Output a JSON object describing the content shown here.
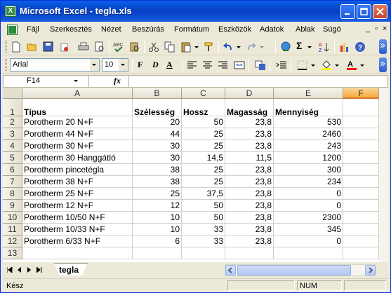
{
  "window": {
    "title": "Microsoft Excel - tegla.xls",
    "app_icon_letter": "X"
  },
  "menu": {
    "items": [
      "Fájl",
      "Szerkesztés",
      "Nézet",
      "Beszúrás",
      "Formátum",
      "Eszközök",
      "Adatok",
      "Ablak",
      "Súgó"
    ],
    "doc_controls": [
      "_",
      "▫",
      "×"
    ]
  },
  "toolbar": {
    "font_name": "Arial",
    "font_size": "10",
    "bold_label": "F",
    "italic_label": "D",
    "underline_label": "A",
    "sum_label": "Σ"
  },
  "formula_bar": {
    "cell_ref": "F14",
    "fx_label": "fx",
    "value": ""
  },
  "grid": {
    "columns": [
      "A",
      "B",
      "C",
      "D",
      "E",
      "F"
    ],
    "selected_column": "F",
    "row_numbers": [
      "1",
      "2",
      "3",
      "4",
      "5",
      "6",
      "7",
      "8",
      "9",
      "10",
      "11",
      "12",
      "13"
    ],
    "headers": [
      "Típus",
      "Szélesség",
      "Hossz",
      "Magasság",
      "Mennyiség"
    ],
    "rows": [
      [
        "Porotherm 20 N+F",
        "20",
        "50",
        "23,8",
        "530"
      ],
      [
        "Porotherm 44 N+F",
        "44",
        "25",
        "23,8",
        "2460"
      ],
      [
        "Porotherm 30 N+F",
        "30",
        "25",
        "23,8",
        "243"
      ],
      [
        "Porotherm 30 Hanggátló",
        "30",
        "14,5",
        "11,5",
        "1200"
      ],
      [
        "Porotherm pincetégla",
        "38",
        "25",
        "23,8",
        "300"
      ],
      [
        "Porotherm 38 N+F",
        "38",
        "25",
        "23,8",
        "234"
      ],
      [
        "Porotherm 25 N+F",
        "25",
        "37,5",
        "23,8",
        "0"
      ],
      [
        "Porotherm 12 N+F",
        "12",
        "50",
        "23,8",
        "0"
      ],
      [
        "Porotherm 10/50 N+F",
        "10",
        "50",
        "23,8",
        "2300"
      ],
      [
        "Porotherm 10/33 N+F",
        "10",
        "33",
        "23,8",
        "345"
      ],
      [
        "Porotherm 6/33 N+F",
        "6",
        "33",
        "23,8",
        "0"
      ]
    ]
  },
  "sheets": {
    "active": "tegla"
  },
  "status": {
    "text": "Kész",
    "num": "NUM"
  }
}
